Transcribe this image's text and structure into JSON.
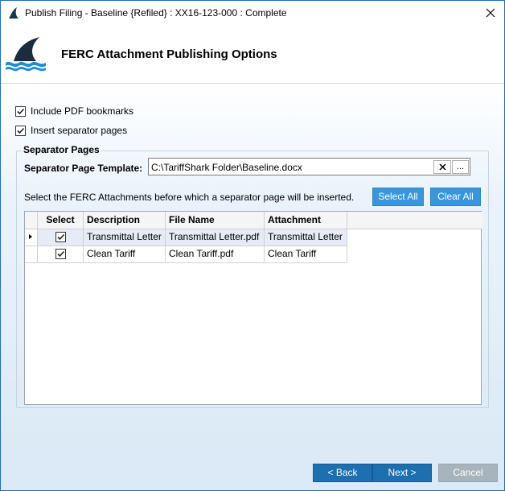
{
  "window": {
    "title": "Publish Filing - Baseline {Refiled} : XX16-123-000 : Complete",
    "close_icon": "close-icon"
  },
  "header": {
    "title": "FERC Attachment Publishing Options",
    "logo": "shark-fin-logo"
  },
  "options": {
    "include_bookmarks": {
      "label": "Include PDF bookmarks",
      "checked": true
    },
    "insert_separators": {
      "label": "Insert separator pages",
      "checked": true
    }
  },
  "separator_group": {
    "legend": "Separator Pages",
    "template_label": "Separator Page Template:",
    "template_value": "C:\\TariffShark Folder\\Baseline.docx",
    "browse_label": "...",
    "hint": "Select the FERC Attachments before which a separator page will be inserted.",
    "select_all": "Select All",
    "clear_all": "Clear All"
  },
  "grid": {
    "columns": [
      "Select",
      "Description",
      "File Name",
      "Attachment"
    ],
    "rows": [
      {
        "selected": true,
        "description": "Transmittal Letter",
        "file_name": "Transmittal Letter.pdf",
        "attachment": "Transmittal Letter"
      },
      {
        "selected": true,
        "description": "Clean Tariff",
        "file_name": "Clean Tariff.pdf",
        "attachment": "Clean Tariff"
      }
    ]
  },
  "footer": {
    "back": "< Back",
    "next": "Next >",
    "cancel": "Cancel"
  },
  "colors": {
    "accent": "#3a96d8",
    "nav_button": "#1e6fb0",
    "disabled_button": "#a7b3bd"
  }
}
